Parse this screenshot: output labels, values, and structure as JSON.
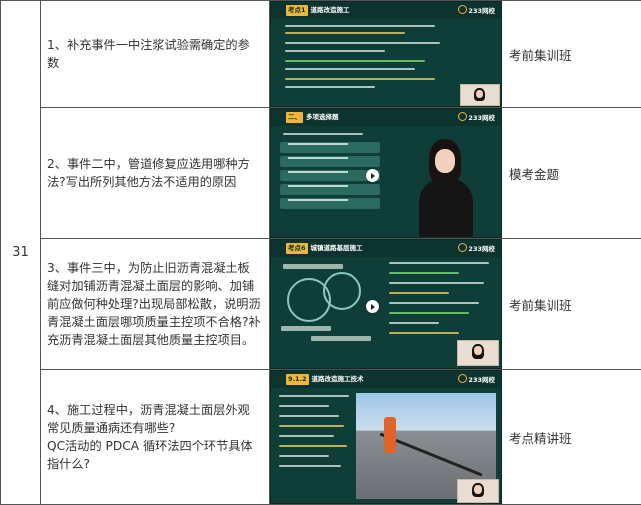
{
  "row_number": "31",
  "rows": [
    {
      "question": "1、补充事件一中注浆试验需确定的参数",
      "course": "考前集训班",
      "thumb": {
        "tag_num": "考点1",
        "tag_title": "道路改造施工",
        "brand": "233网校"
      }
    },
    {
      "question": "2、事件二中，管道修复应选用哪种方法?写出所列其他方法不适用的原因",
      "course": "模考金题",
      "thumb": {
        "tag_num": "二、",
        "tag_title": "多项选择题",
        "brand": "233网校"
      }
    },
    {
      "question": "3、事件三中，为防止旧沥青混凝土板缝对加铺沥青混凝土面层的影响、加铺前应做何种处理?出现局部松散，说明沥青混凝土面层哪项质量主控项不合格?补充沥青混凝土面层其他质量主控项目。",
      "course": "考前集训班",
      "thumb": {
        "tag_num": "考点6",
        "tag_title": "城镇道路基层施工",
        "brand": "233网校"
      }
    },
    {
      "question": "4、施工过程中，沥青混凝土面层外观常见质量通病还有哪些?\nQC活动的 PDCA 循环法四个环节具体指什么?",
      "course": "考点精讲班",
      "thumb": {
        "tag_num": "9.1.2",
        "tag_title": "道路改造施工技术",
        "brand": "233网校"
      }
    }
  ],
  "colors": {
    "thumb_bg": "#0f3d38",
    "accent": "#f0b53a",
    "border": "#555555"
  }
}
